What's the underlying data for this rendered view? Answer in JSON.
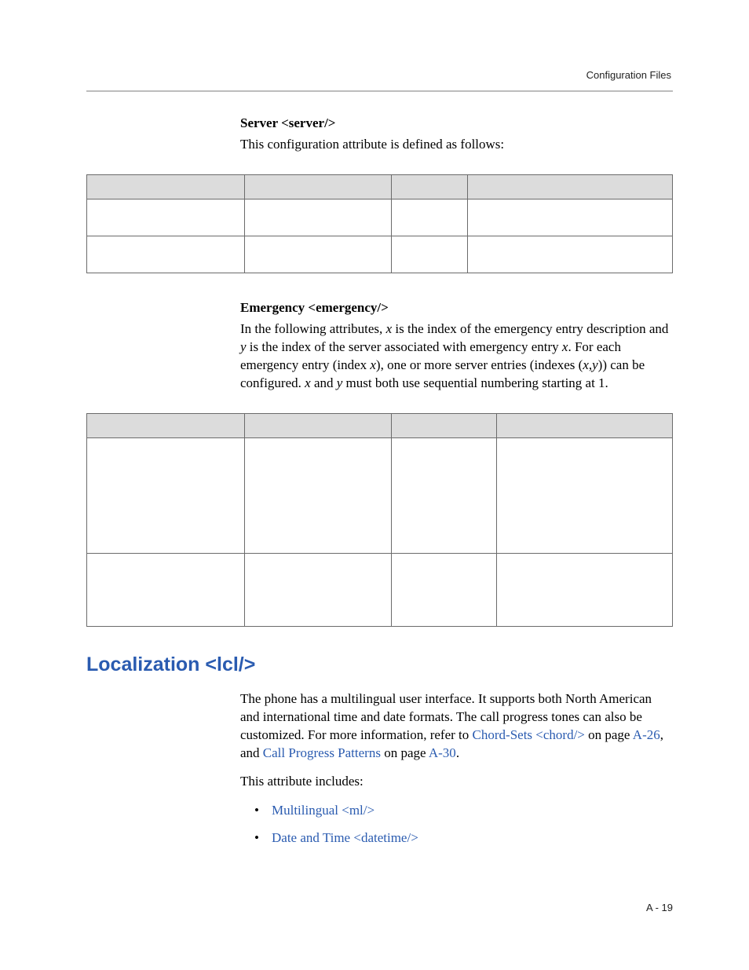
{
  "header": {
    "section": "Configuration Files"
  },
  "server": {
    "title": "Server <server/>",
    "intro": "This configuration attribute is defined as follows:"
  },
  "emergency": {
    "title": "Emergency <emergency/>",
    "p1a": "In the following attributes, ",
    "xi": "x",
    "p1b": " is the index of the emergency entry description and ",
    "yi": "y",
    "p1c": " is the index of the server associated with emergency entry ",
    "p1d": ". For each emergency entry (index ",
    "p1e": "), one or more server entries (indexes (",
    "comma": ",",
    "p1f": ")) can be configured. ",
    "p1g": " and ",
    "p1h": " must both use sequential numbering starting at 1."
  },
  "localization": {
    "heading": "Localization <lcl/>",
    "p1a": "The phone has a multilingual user interface. It supports both North American and international time and date formats. The call progress tones can also be customized. For more information, refer to ",
    "link1": "Chord-Sets <chord/>",
    "p1b": " on page ",
    "pageref1": "A-26",
    "p1c": ", and ",
    "link2": "Call Progress Patterns",
    "p1d": " on page ",
    "pageref2": "A-30",
    "period": ".",
    "p2": "This attribute includes:",
    "bullets": {
      "0": "Multilingual <ml/>",
      "1": "Date and Time <datetime/>"
    }
  },
  "footer": {
    "pagenum": "A - 19"
  }
}
